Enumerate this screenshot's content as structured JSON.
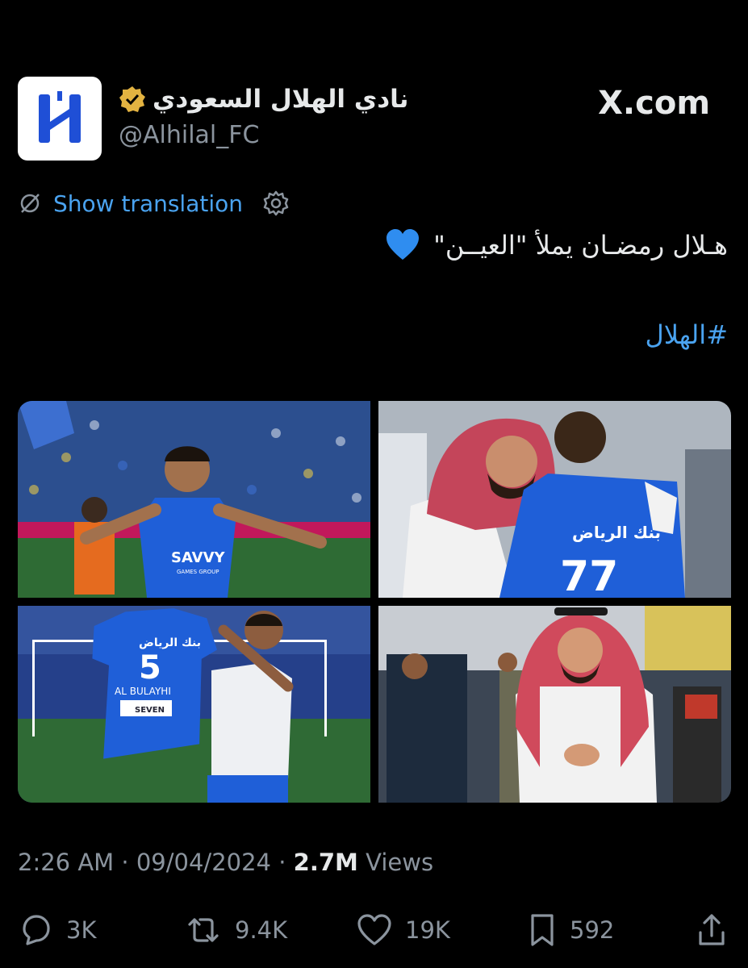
{
  "account": {
    "display_name": "نادي الهلال السعودي",
    "handle": "@Alhilal_FC",
    "verified_badge": "verified-badge-gold",
    "avatar_logo": "alhilal-logo"
  },
  "site": {
    "brand": "X.com"
  },
  "translation": {
    "label": "Show translation"
  },
  "tweet": {
    "text": "هـلال رمضـان يملأ \"العيــن\"",
    "emoji": "💙",
    "hashtag": "#الهلال"
  },
  "media": {
    "photos": [
      {
        "alt_icon": "player-celebrating-photo",
        "jersey_text": "SAVVY",
        "jersey_subtext": "GAMES GROUP"
      },
      {
        "alt_icon": "official-hugging-player-photo",
        "jersey_text": "بنك الرياض",
        "jersey_number": "77"
      },
      {
        "alt_icon": "player-holding-shirt-photo",
        "jersey_text": "بنك الرياض",
        "jersey_number": "5",
        "jersey_name": "AL BULAYHI",
        "jersey_sponsor": "SEVEN"
      },
      {
        "alt_icon": "official-in-stadium-photo"
      }
    ]
  },
  "meta": {
    "time": "2:26 AM",
    "separator": " · ",
    "date": "09/04/2024",
    "views_count": "2.7M",
    "views_label": " Views"
  },
  "actions": {
    "replies": "3K",
    "reposts": "9.4K",
    "likes": "19K",
    "bookmarks": "592"
  },
  "colors": {
    "background": "#000000",
    "link_blue": "#4aa3f0",
    "hilal_blue": "#1f4fd6",
    "muted": "#8b949e"
  }
}
